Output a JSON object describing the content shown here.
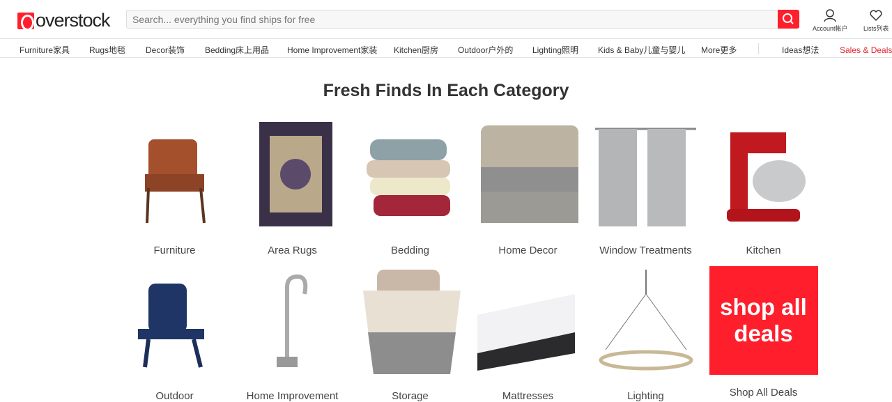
{
  "header": {
    "logo": "overstock",
    "search_placeholder": "Search... everything you find ships for free",
    "account_label": "Account帐户",
    "lists_label": "Lists列表"
  },
  "nav": [
    "Furniture家具",
    "Rugs地毯",
    "Decor装饰",
    "Bedding床上用品",
    "Home Improvement家装",
    "Kitchen厨房",
    "Outdoor户外的",
    "Lighting照明",
    "Kids & Baby儿童与婴儿",
    "More更多",
    "Ideas想法",
    "Sales & Deals特"
  ],
  "colors": {
    "brand": "#ff1f2c"
  },
  "main": {
    "title": "Fresh Finds In Each Category",
    "categories": [
      "Furniture",
      "Area Rugs",
      "Bedding",
      "Home Decor",
      "Window Treatments",
      "Kitchen",
      "Outdoor",
      "Home Improvement",
      "Storage",
      "Mattresses",
      "Lighting",
      "Shop All Deals"
    ],
    "deals_tile": "shop all deals"
  }
}
